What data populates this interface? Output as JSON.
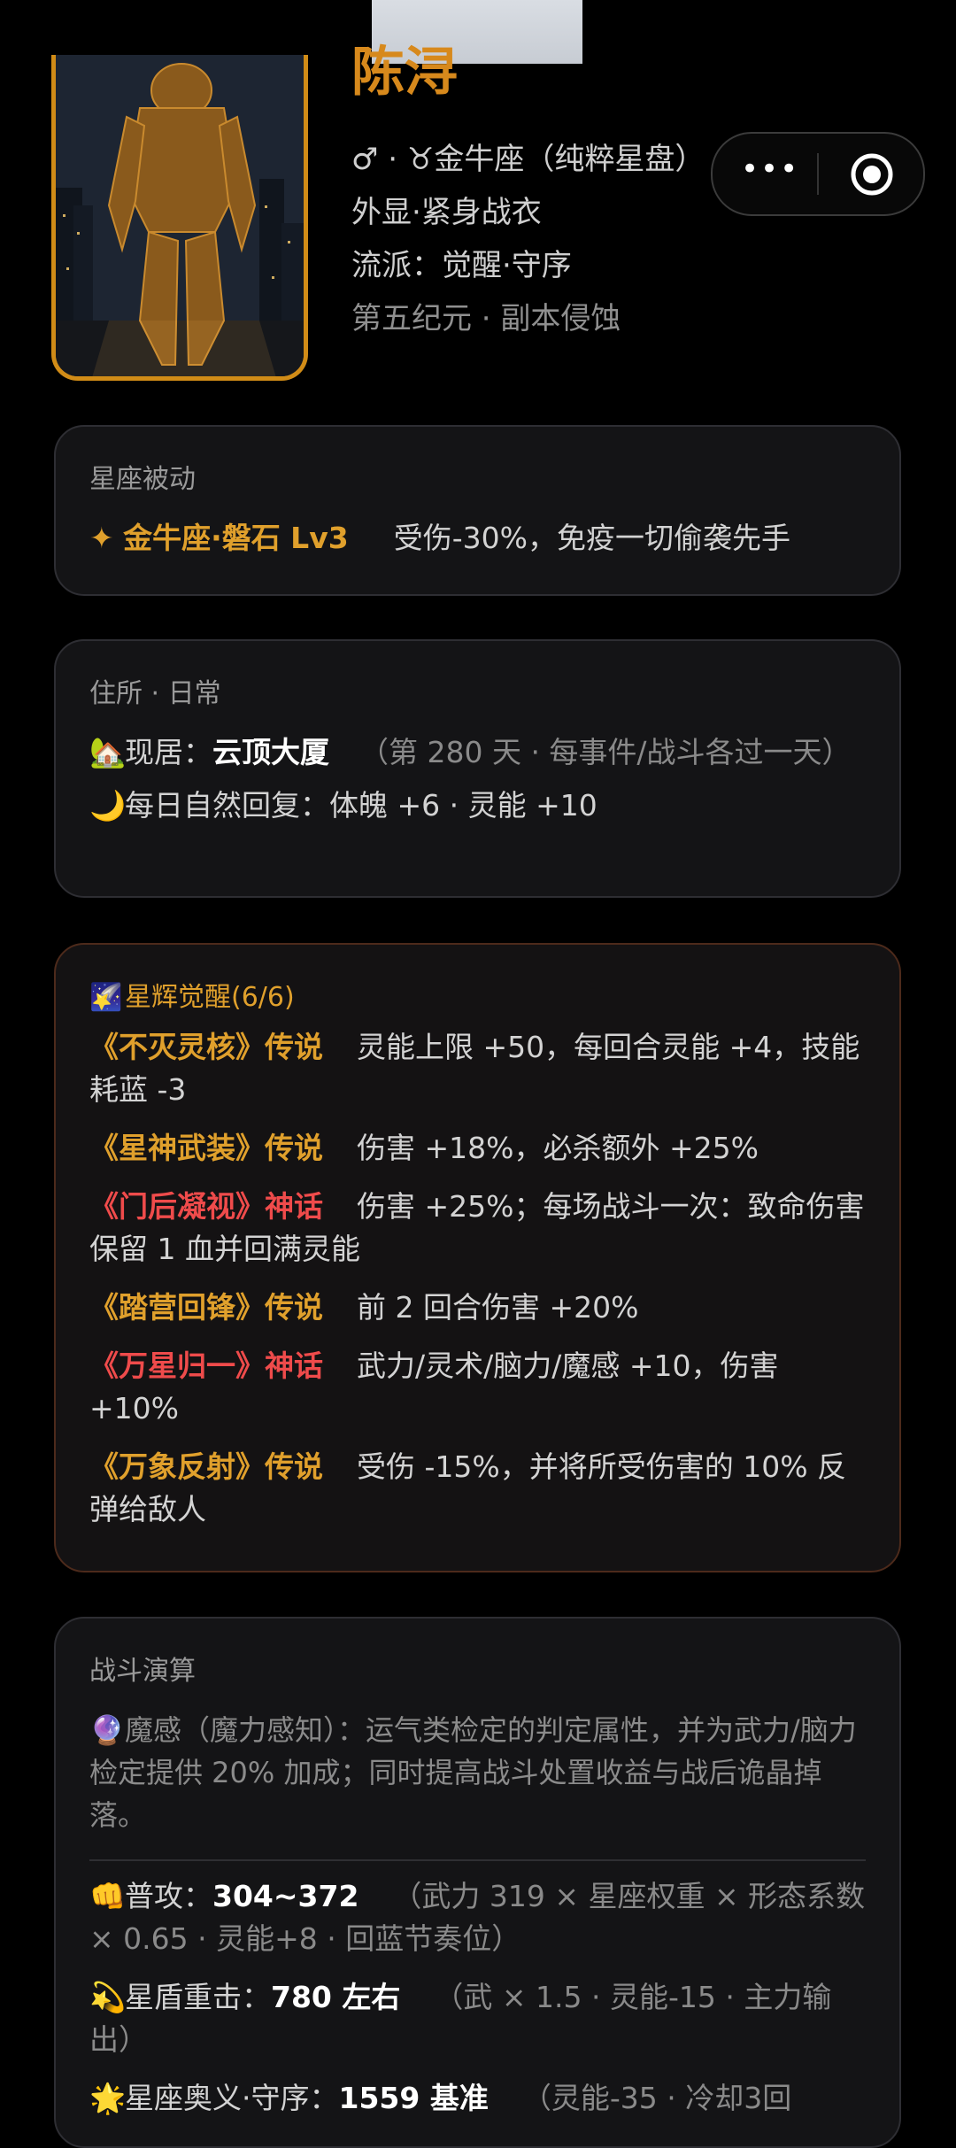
{
  "top_strip": {},
  "portrait": {
    "alt": "hero-portrait"
  },
  "hero": {
    "name": "陈浔",
    "line1": "♂ · ♉金牛座（纯粹星盘）",
    "line2": "外显·紧身战衣",
    "line3": "流派：觉醒·守序",
    "line4": "第五纪元 · 副本侵蚀"
  },
  "capsule": {
    "more": "•••",
    "close": "◉"
  },
  "passive": {
    "title": "星座被动",
    "star_icon": "✦",
    "name": "金牛座·磐石 Lv3",
    "desc": "受伤-30%，免疫一切偷袭先手"
  },
  "home": {
    "title": "住所 · 日常",
    "house_icon": "🏡",
    "label": "现居：",
    "place": "云顶大厦",
    "note": "（第 280 天 · 每事件/战斗各过一天）",
    "moon_icon": "🌙",
    "daily": "每日自然回复：体魄 +6 · 灵能 +10"
  },
  "awaken": {
    "title_icon": "🌠",
    "title": "星辉觉醒(6/6)",
    "items": [
      {
        "name": "《不灭灵核》传说",
        "tier": "gold",
        "desc": "灵能上限 +50，每回合灵能 +4，技能耗蓝 -3"
      },
      {
        "name": "《星神武装》传说",
        "tier": "gold",
        "desc": "伤害 +18%，必杀额外 +25%"
      },
      {
        "name": "《门后凝视》神话",
        "tier": "red",
        "desc": "伤害 +25%；每场战斗一次：致命伤害保留 1 血并回满灵能"
      },
      {
        "name": "《踏营回锋》传说",
        "tier": "gold",
        "desc": "前 2 回合伤害 +20%"
      },
      {
        "name": "《万星归一》神话",
        "tier": "red",
        "desc": "武力/灵术/脑力/魔感 +10，伤害 +10%"
      },
      {
        "name": "《万象反射》传说",
        "tier": "gold",
        "desc": "受伤 -15%，并将所受伤害的 10% 反弹给敌人"
      }
    ]
  },
  "battle": {
    "title": "战斗演算",
    "intro_icon": "🔮",
    "intro": "魔感（魔力感知）：运气类检定的判定属性，并为武力/脑力检定提供 20% 加成；同时提高战斗处置收益与战后诡晶掉落。",
    "rows": [
      {
        "icon": "👊",
        "label": "普攻：",
        "value": "304~372",
        "note": "（武力 319 × 星座权重 × 形态系数 × 0.65 · 灵能+8 · 回蓝节奏位）"
      },
      {
        "icon": "💫",
        "label": "星盾重击：",
        "value": "780 左右",
        "note": "（武 × 1.5 · 灵能-15 · 主力输出）"
      },
      {
        "icon": "🌟",
        "label": "星座奥义·守序：",
        "value": "1559 基准",
        "note": "（灵能-35 · 冷却3回"
      }
    ]
  }
}
